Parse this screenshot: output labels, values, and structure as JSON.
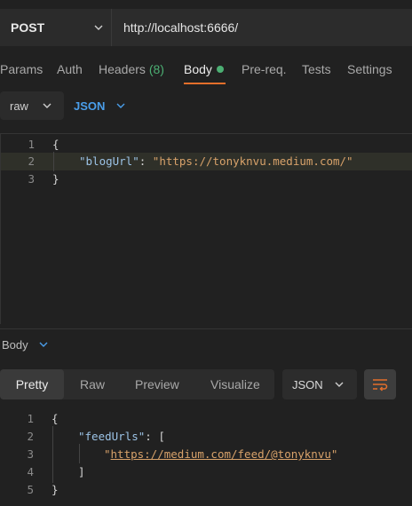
{
  "request": {
    "method": "POST",
    "url": "http://localhost:6666/"
  },
  "tabs": {
    "params": "Params",
    "auth": "Auth",
    "headers": "Headers",
    "headers_count": "(8)",
    "body": "Body",
    "prereq": "Pre-req.",
    "tests": "Tests",
    "settings": "Settings"
  },
  "body_mode": {
    "type": "raw",
    "format": "JSON"
  },
  "request_body": {
    "lines": [
      {
        "n": "1",
        "text": "{"
      },
      {
        "n": "2",
        "key": "\"blogUrl\"",
        "sep": ": ",
        "value": "\"https://tonyknvu.medium.com/\""
      },
      {
        "n": "3",
        "text": "}"
      }
    ]
  },
  "response": {
    "label": "Body",
    "views": [
      "Pretty",
      "Raw",
      "Preview",
      "Visualize"
    ],
    "format": "JSON",
    "lines": [
      {
        "n": "1",
        "text": "{"
      },
      {
        "n": "2",
        "key": "\"feedUrls\"",
        "rest": ": ["
      },
      {
        "n": "3",
        "q1": "\"",
        "link": "https://medium.com/feed/@tonyknvu",
        "q2": "\""
      },
      {
        "n": "4",
        "text": "]"
      },
      {
        "n": "5",
        "text": "}"
      }
    ]
  },
  "colors": {
    "accent": "#e46f2b",
    "green": "#4caf73",
    "blue": "#4a9eea"
  }
}
